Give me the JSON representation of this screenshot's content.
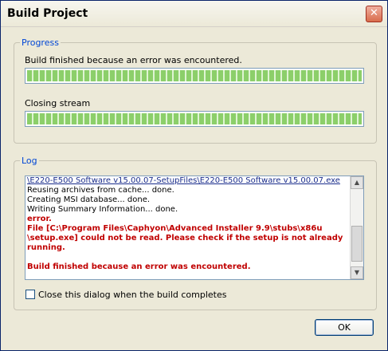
{
  "window": {
    "title": "Build Project",
    "close_glyph": "✕"
  },
  "progress_group": {
    "title": "Progress",
    "status_text": "Build finished because an error was encountered.",
    "status_progress_percent": 100,
    "stream_text": "Closing stream",
    "stream_progress_percent": 100
  },
  "log_group": {
    "title": "Log",
    "lines": [
      {
        "text": "\\E220-E500 Software v15.00.07-SetupFiles\\E220-E500 Software v15.00.07.exe",
        "style": "link"
      },
      {
        "text": "Reusing archives from cache... done.",
        "style": "normal"
      },
      {
        "text": "Creating MSI database... done.",
        "style": "normal"
      },
      {
        "text": "Writing Summary Information... done.",
        "style": "normal"
      },
      {
        "text": "error.",
        "style": "error"
      },
      {
        "text": "File [C:\\Program Files\\Caphyon\\Advanced Installer 9.9\\stubs\\x86u",
        "style": "error"
      },
      {
        "text": "\\setup.exe] could not be read. Please check if the setup is not already",
        "style": "error"
      },
      {
        "text": "running.",
        "style": "error"
      },
      {
        "text": "",
        "style": "normal"
      },
      {
        "text": "Build finished because an error was encountered.",
        "style": "error"
      }
    ],
    "scroll_up_glyph": "▲",
    "scroll_down_glyph": "▼"
  },
  "close_dialog_checkbox": {
    "label": "Close this dialog when the build completes",
    "checked": false
  },
  "ok_button": {
    "label": "OK"
  }
}
